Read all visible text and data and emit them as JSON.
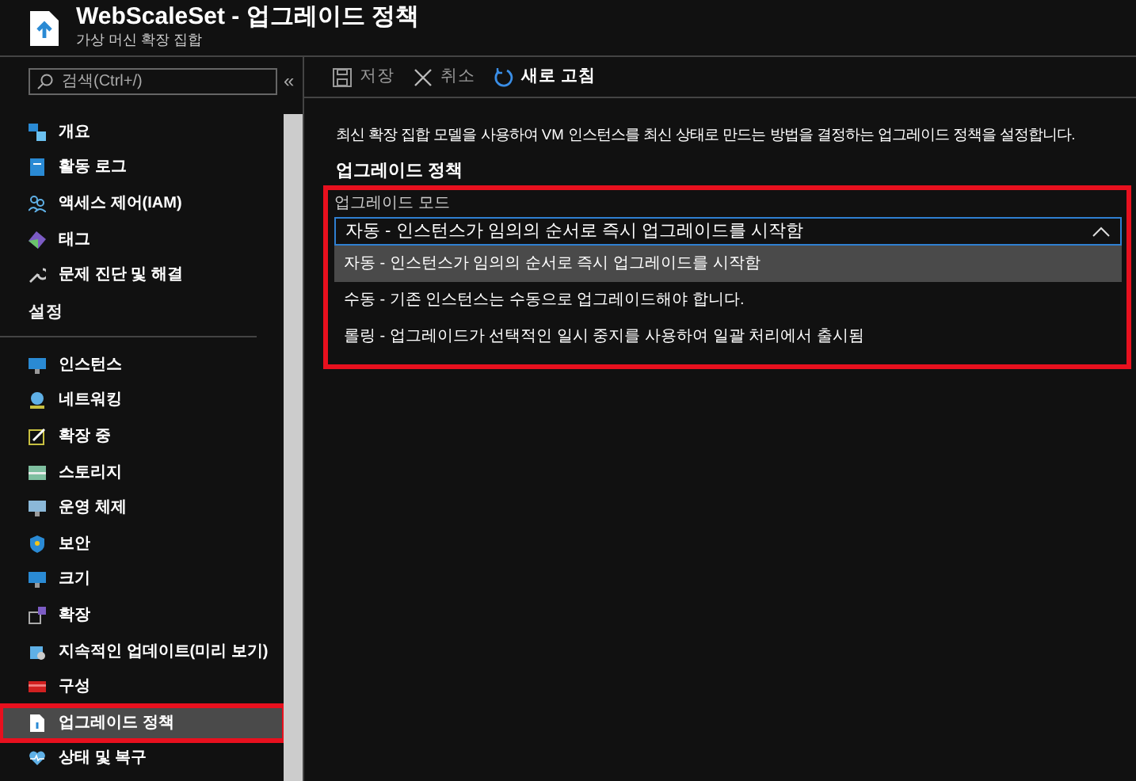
{
  "header": {
    "title": "WebScaleSet - 업그레이드 정책",
    "subtitle": "가상 머신 확장 집합"
  },
  "sidebar": {
    "search": {
      "placeholder": "검색(Ctrl+/)"
    },
    "collapse": "«",
    "items": [
      {
        "kind": "item",
        "label": "개요",
        "selected": false,
        "highlighted": false
      },
      {
        "kind": "item",
        "label": "활동 로그",
        "selected": false,
        "highlighted": false
      },
      {
        "kind": "item",
        "label": "액세스 제어(IAM)",
        "selected": false,
        "highlighted": false
      },
      {
        "kind": "item",
        "label": "태그",
        "selected": false,
        "highlighted": false
      },
      {
        "kind": "item",
        "label": "문제 진단 및 해결",
        "selected": false,
        "highlighted": false
      },
      {
        "kind": "section",
        "label": "설정"
      },
      {
        "kind": "item",
        "label": "인스턴스",
        "selected": false,
        "highlighted": false
      },
      {
        "kind": "item",
        "label": "네트워킹",
        "selected": false,
        "highlighted": false
      },
      {
        "kind": "item",
        "label": "확장 중",
        "selected": false,
        "highlighted": false
      },
      {
        "kind": "item",
        "label": "스토리지",
        "selected": false,
        "highlighted": false
      },
      {
        "kind": "item",
        "label": "운영 체제",
        "selected": false,
        "highlighted": false
      },
      {
        "kind": "item",
        "label": "보안",
        "selected": false,
        "highlighted": false
      },
      {
        "kind": "item",
        "label": "크기",
        "selected": false,
        "highlighted": false
      },
      {
        "kind": "item",
        "label": "확장",
        "selected": false,
        "highlighted": false
      },
      {
        "kind": "item",
        "label": "지속적인 업데이트(미리 보기)",
        "selected": false,
        "highlighted": false
      },
      {
        "kind": "item",
        "label": "구성",
        "selected": false,
        "highlighted": false
      },
      {
        "kind": "item",
        "label": "업그레이드 정책",
        "selected": true,
        "highlighted": true
      },
      {
        "kind": "item",
        "label": "상태 및 복구",
        "selected": false,
        "highlighted": false
      }
    ]
  },
  "toolbar": [
    {
      "kind": "save",
      "label": "저장",
      "disabled": true
    },
    {
      "kind": "cancel",
      "label": "취소",
      "disabled": true
    },
    {
      "kind": "refresh",
      "label": "새로 고침",
      "disabled": false
    }
  ],
  "description": "최신 확장 집합 모델을 사용하여 VM 인스턴스를 최신 상태로 만드는 방법을 결정하는 업그레이드 정책을 설정합니다.",
  "policy": {
    "heading": "업그레이드 정책",
    "highlighted": true,
    "label": "업그레이드 모드",
    "value": "자동 - 인스턴스가 임의의 순서로 즉시 업그레이드를 시작함",
    "expanded": true,
    "options": [
      {
        "label": "자동 - 인스턴스가 임의의 순서로 즉시 업그레이드를 시작함",
        "selected": true
      },
      {
        "label": "수동 - 기존 인스턴스는 수동으로 업그레이드해야 합니다.",
        "selected": false
      },
      {
        "label": "롤링 - 업그레이드가 선택적인 일시 중지를 사용하여 일괄 처리에서 출시됨",
        "selected": false
      }
    ]
  }
}
